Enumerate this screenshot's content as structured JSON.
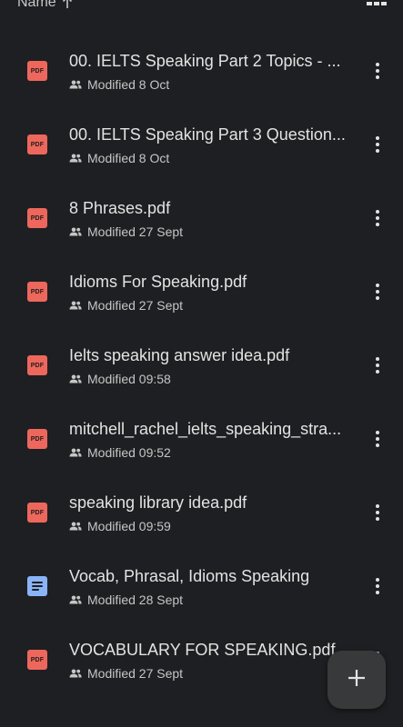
{
  "header": {
    "sort_label": "Name",
    "sort_direction_icon": "arrow-up-icon",
    "view_toggle_icon": "grid-view-icon"
  },
  "files": [
    {
      "name": "00. IELTS Speaking Part 2 Topics - ...",
      "type": "pdf",
      "icon_label": "PDF",
      "modified": "Modified 8 Oct",
      "shared": true
    },
    {
      "name": "00. IELTS Speaking Part 3 Question...",
      "type": "pdf",
      "icon_label": "PDF",
      "modified": "Modified 8 Oct",
      "shared": true
    },
    {
      "name": "8 Phrases.pdf",
      "type": "pdf",
      "icon_label": "PDF",
      "modified": "Modified 27 Sept",
      "shared": true
    },
    {
      "name": "Idioms For Speaking.pdf",
      "type": "pdf",
      "icon_label": "PDF",
      "modified": "Modified 27 Sept",
      "shared": true
    },
    {
      "name": "Ielts speaking answer idea.pdf",
      "type": "pdf",
      "icon_label": "PDF",
      "modified": "Modified 09:58",
      "shared": true
    },
    {
      "name": "mitchell_rachel_ielts_speaking_stra...",
      "type": "pdf",
      "icon_label": "PDF",
      "modified": "Modified 09:52",
      "shared": true
    },
    {
      "name": "speaking library idea.pdf",
      "type": "pdf",
      "icon_label": "PDF",
      "modified": "Modified 09:59",
      "shared": true
    },
    {
      "name": "Vocab, Phrasal, Idioms Speaking",
      "type": "doc",
      "icon_label": "",
      "modified": "Modified 28 Sept",
      "shared": true
    },
    {
      "name": "VOCABULARY FOR SPEAKING.pdf",
      "type": "pdf",
      "icon_label": "PDF",
      "modified": "Modified 27 Sept",
      "shared": true
    }
  ],
  "fab": {
    "icon": "plus-icon"
  },
  "colors": {
    "background": "#1e1f22",
    "pdf": "#ee675c",
    "doc": "#8ab4f8",
    "text_primary": "#e3e3e3",
    "text_secondary": "#c4c7c5",
    "fab": "#37393b"
  }
}
